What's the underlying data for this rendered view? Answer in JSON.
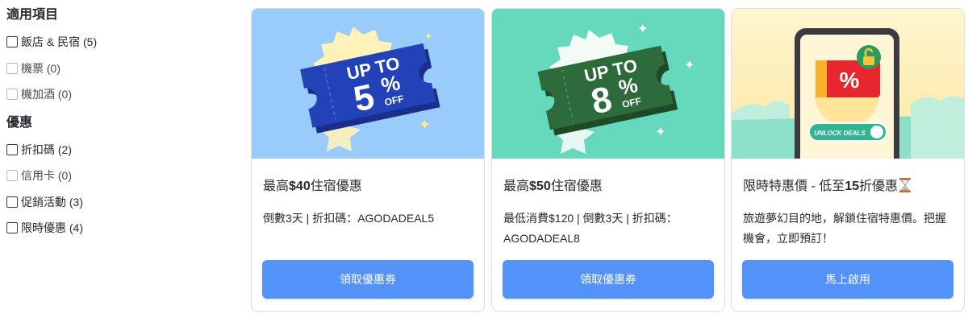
{
  "sidebar": {
    "sections": [
      {
        "title": "適用項目",
        "items": [
          {
            "label": "飯店 & 民宿 (5)"
          },
          {
            "label": "機票 (0)"
          },
          {
            "label": "機加酒 (0)"
          }
        ]
      },
      {
        "title": "優惠",
        "items": [
          {
            "label": "折扣碼 (2)"
          },
          {
            "label": "信用卡 (0)"
          },
          {
            "label": "促銷活動 (3)"
          },
          {
            "label": "限時優惠 (4)"
          }
        ]
      }
    ]
  },
  "cards": [
    {
      "image": {
        "line1": "UP TO",
        "value": "5",
        "percent": "%",
        "off": "OFF",
        "bg": "#99ccfb",
        "ticket_color": "#2442b8"
      },
      "title_prefix": "最高",
      "title_bold": "$40",
      "title_suffix": "住宿優惠",
      "description": "倒數3天 | 折扣碼：AGODADEAL5",
      "button": "領取優惠券"
    },
    {
      "image": {
        "line1": "UP TO",
        "value": "8",
        "percent": "%",
        "off": "OFF",
        "bg": "#66d9bd",
        "ticket_color": "#2e6b3a"
      },
      "title_prefix": "最高",
      "title_bold": "$50",
      "title_suffix": "住宿優惠",
      "description": "最低消費$120 | 倒數3天 | 折扣碼：AGODADEAL8",
      "button": "領取優惠券"
    },
    {
      "image": {
        "symbol": "%",
        "unlock_label": "UNLOCK DEALS",
        "bg": "#fff3c4"
      },
      "title_prefix": "限時特惠價 - 低至",
      "title_bold": "15",
      "title_suffix": "折優惠",
      "title_icon": "hourglass-icon",
      "description": "旅遊夢幻目的地，解鎖住宿特惠價。把握機會，立即預訂！",
      "button": "馬上啟用"
    }
  ]
}
